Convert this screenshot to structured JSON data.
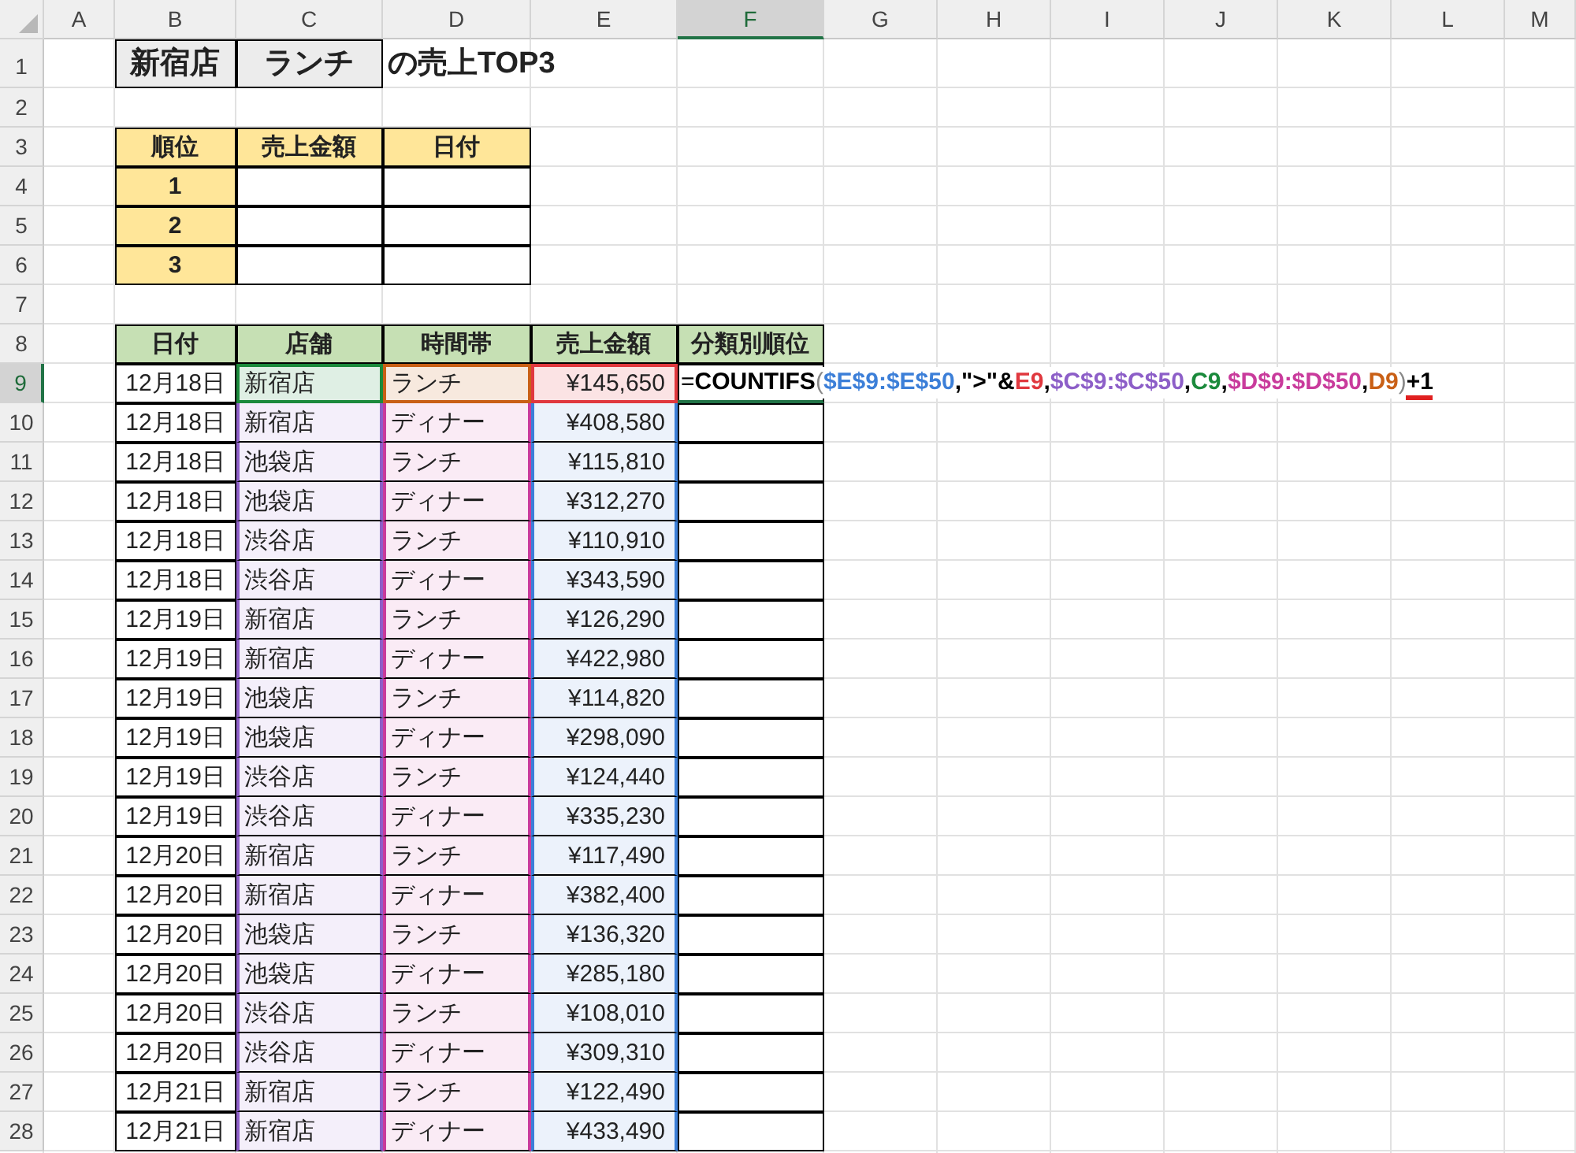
{
  "column_headers": [
    {
      "label": "A",
      "selected": false
    },
    {
      "label": "B",
      "selected": false
    },
    {
      "label": "C",
      "selected": false
    },
    {
      "label": "D",
      "selected": false
    },
    {
      "label": "E",
      "selected": false
    },
    {
      "label": "F",
      "selected": true
    },
    {
      "label": "G",
      "selected": false
    },
    {
      "label": "H",
      "selected": false
    },
    {
      "label": "I",
      "selected": false
    },
    {
      "label": "J",
      "selected": false
    },
    {
      "label": "K",
      "selected": false
    },
    {
      "label": "L",
      "selected": false
    },
    {
      "label": "M",
      "selected": false
    }
  ],
  "row_headers": [
    {
      "label": "1",
      "selected": false
    },
    {
      "label": "2",
      "selected": false
    },
    {
      "label": "3",
      "selected": false
    },
    {
      "label": "4",
      "selected": false
    },
    {
      "label": "5",
      "selected": false
    },
    {
      "label": "6",
      "selected": false
    },
    {
      "label": "7",
      "selected": false
    },
    {
      "label": "8",
      "selected": false
    },
    {
      "label": "9",
      "selected": true
    },
    {
      "label": "10",
      "selected": false
    },
    {
      "label": "11",
      "selected": false
    },
    {
      "label": "12",
      "selected": false
    },
    {
      "label": "13",
      "selected": false
    },
    {
      "label": "14",
      "selected": false
    },
    {
      "label": "15",
      "selected": false
    },
    {
      "label": "16",
      "selected": false
    },
    {
      "label": "17",
      "selected": false
    },
    {
      "label": "18",
      "selected": false
    },
    {
      "label": "19",
      "selected": false
    },
    {
      "label": "20",
      "selected": false
    },
    {
      "label": "21",
      "selected": false
    },
    {
      "label": "22",
      "selected": false
    },
    {
      "label": "23",
      "selected": false
    },
    {
      "label": "24",
      "selected": false
    },
    {
      "label": "25",
      "selected": false
    },
    {
      "label": "26",
      "selected": false
    },
    {
      "label": "27",
      "selected": false
    },
    {
      "label": "28",
      "selected": false
    }
  ],
  "title": {
    "store": "新宿店",
    "slot": "ランチ",
    "suffix": "の売上TOP3"
  },
  "top3_table": {
    "columns": [
      "順位",
      "売上金額",
      "日付"
    ],
    "rows": [
      {
        "rank": "1"
      },
      {
        "rank": "2"
      },
      {
        "rank": "3"
      }
    ]
  },
  "sales_table": {
    "columns": [
      {
        "label": "日付"
      },
      {
        "label": "店舗",
        "color": "#8d5fc8"
      },
      {
        "label": "時間帯",
        "color": "#c93b9c"
      },
      {
        "label": "売上金額",
        "color": "#3c7fd8"
      },
      {
        "label": "分類別順位"
      }
    ],
    "rows": [
      {
        "cells": [
          "12月18日",
          "新宿店",
          "ランチ",
          "¥145,650"
        ],
        "highlights": [
          {
            "color": "#1b8a3c"
          },
          {
            "color": "#c96016"
          },
          {
            "color": "#e0383e"
          }
        ],
        "formula": [
          {
            "text": "=",
            "color": "#000000",
            "bold": false,
            "underlined": false
          },
          {
            "text": "COUNTIFS",
            "color": "#000000",
            "bold": true,
            "underlined": false
          },
          {
            "text": "(",
            "color": "#888888",
            "bold": false,
            "underlined": false
          },
          {
            "text": "$E$9:$E$50",
            "color": "#3c7fd8",
            "bold": true,
            "underlined": false
          },
          {
            "text": ",\">\"&",
            "color": "#000000",
            "bold": true,
            "underlined": false
          },
          {
            "text": "E9",
            "color": "#e0383e",
            "bold": true,
            "underlined": false
          },
          {
            "text": ",",
            "color": "#000000",
            "bold": true,
            "underlined": false
          },
          {
            "text": "$C$9:$C$50",
            "color": "#8d5fc8",
            "bold": true,
            "underlined": false
          },
          {
            "text": ",",
            "color": "#000000",
            "bold": true,
            "underlined": false
          },
          {
            "text": "C9",
            "color": "#1b8a3c",
            "bold": true,
            "underlined": false
          },
          {
            "text": ",",
            "color": "#000000",
            "bold": true,
            "underlined": false
          },
          {
            "text": "$D$9:$D$50",
            "color": "#c93b9c",
            "bold": true,
            "underlined": false
          },
          {
            "text": ",",
            "color": "#000000",
            "bold": true,
            "underlined": false
          },
          {
            "text": "D9",
            "color": "#c96016",
            "bold": true,
            "underlined": false
          },
          {
            "text": ")",
            "color": "#888888",
            "bold": false,
            "underlined": false
          },
          {
            "text": "+1",
            "color": "#000000",
            "bold": true,
            "underlined": true
          }
        ]
      },
      {
        "cells": [
          "12月18日",
          "新宿店",
          "ディナー",
          "¥408,580"
        ]
      },
      {
        "cells": [
          "12月18日",
          "池袋店",
          "ランチ",
          "¥115,810"
        ]
      },
      {
        "cells": [
          "12月18日",
          "池袋店",
          "ディナー",
          "¥312,270"
        ]
      },
      {
        "cells": [
          "12月18日",
          "渋谷店",
          "ランチ",
          "¥110,910"
        ]
      },
      {
        "cells": [
          "12月18日",
          "渋谷店",
          "ディナー",
          "¥343,590"
        ]
      },
      {
        "cells": [
          "12月19日",
          "新宿店",
          "ランチ",
          "¥126,290"
        ]
      },
      {
        "cells": [
          "12月19日",
          "新宿店",
          "ディナー",
          "¥422,980"
        ]
      },
      {
        "cells": [
          "12月19日",
          "池袋店",
          "ランチ",
          "¥114,820"
        ]
      },
      {
        "cells": [
          "12月19日",
          "池袋店",
          "ディナー",
          "¥298,090"
        ]
      },
      {
        "cells": [
          "12月19日",
          "渋谷店",
          "ランチ",
          "¥124,440"
        ]
      },
      {
        "cells": [
          "12月19日",
          "渋谷店",
          "ディナー",
          "¥335,230"
        ]
      },
      {
        "cells": [
          "12月20日",
          "新宿店",
          "ランチ",
          "¥117,490"
        ]
      },
      {
        "cells": [
          "12月20日",
          "新宿店",
          "ディナー",
          "¥382,400"
        ]
      },
      {
        "cells": [
          "12月20日",
          "池袋店",
          "ランチ",
          "¥136,320"
        ]
      },
      {
        "cells": [
          "12月20日",
          "池袋店",
          "ディナー",
          "¥285,180"
        ]
      },
      {
        "cells": [
          "12月20日",
          "渋谷店",
          "ランチ",
          "¥108,010"
        ]
      },
      {
        "cells": [
          "12月20日",
          "渋谷店",
          "ディナー",
          "¥309,310"
        ]
      },
      {
        "cells": [
          "12月21日",
          "新宿店",
          "ランチ",
          "¥122,490"
        ]
      },
      {
        "cells": [
          "12月21日",
          "新宿店",
          "ディナー",
          "¥433,490"
        ]
      }
    ]
  }
}
